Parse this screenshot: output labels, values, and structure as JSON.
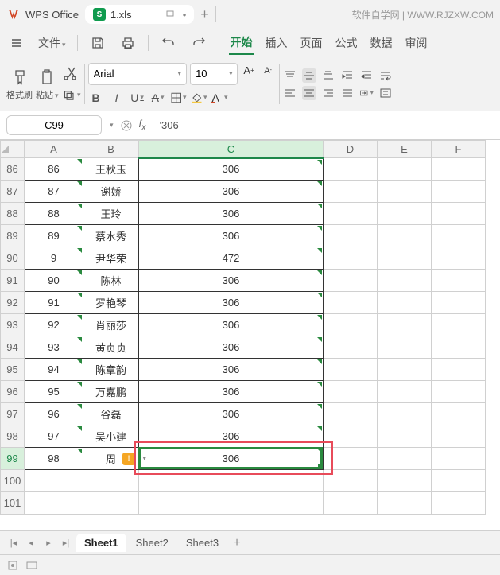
{
  "app": {
    "name": "WPS Office"
  },
  "tab": {
    "file_icon": "S",
    "filename": "1.xls"
  },
  "watermark": "软件自学网 | WWW.RJZXW.COM",
  "menu": {
    "file": "文件",
    "items": [
      "开始",
      "插入",
      "页面",
      "公式",
      "数据",
      "审阅"
    ]
  },
  "toolbar": {
    "format_brush": "格式刷",
    "paste": "粘贴",
    "font_name": "Arial",
    "font_size": "10"
  },
  "formula_bar": {
    "cell": "C99",
    "value": "'306"
  },
  "columns": [
    "A",
    "B",
    "C",
    "D",
    "E",
    "F"
  ],
  "rows": [
    {
      "n": 86,
      "a": "86",
      "b": "王秋玉",
      "c": "306"
    },
    {
      "n": 87,
      "a": "87",
      "b": "谢娇",
      "c": "306"
    },
    {
      "n": 88,
      "a": "88",
      "b": "王玲",
      "c": "306"
    },
    {
      "n": 89,
      "a": "89",
      "b": "蔡水秀",
      "c": "306"
    },
    {
      "n": 90,
      "a": "9",
      "b": "尹华荣",
      "c": "472"
    },
    {
      "n": 91,
      "a": "90",
      "b": "陈林",
      "c": "306"
    },
    {
      "n": 92,
      "a": "91",
      "b": "罗艳琴",
      "c": "306"
    },
    {
      "n": 93,
      "a": "92",
      "b": "肖丽莎",
      "c": "306"
    },
    {
      "n": 94,
      "a": "93",
      "b": "黄贞贞",
      "c": "306"
    },
    {
      "n": 95,
      "a": "94",
      "b": "陈章韵",
      "c": "306"
    },
    {
      "n": 96,
      "a": "95",
      "b": "万嘉鹏",
      "c": "306"
    },
    {
      "n": 97,
      "a": "96",
      "b": "谷磊",
      "c": "306"
    },
    {
      "n": 98,
      "a": "97",
      "b": "吴小建",
      "c": "306"
    },
    {
      "n": 99,
      "a": "98",
      "b": "周",
      "c": "306"
    }
  ],
  "blank_rows": [
    100,
    101
  ],
  "sheets": [
    "Sheet1",
    "Sheet2",
    "Sheet3"
  ],
  "active_sheet": 0,
  "active_cell": {
    "row": 99,
    "col": "C"
  }
}
